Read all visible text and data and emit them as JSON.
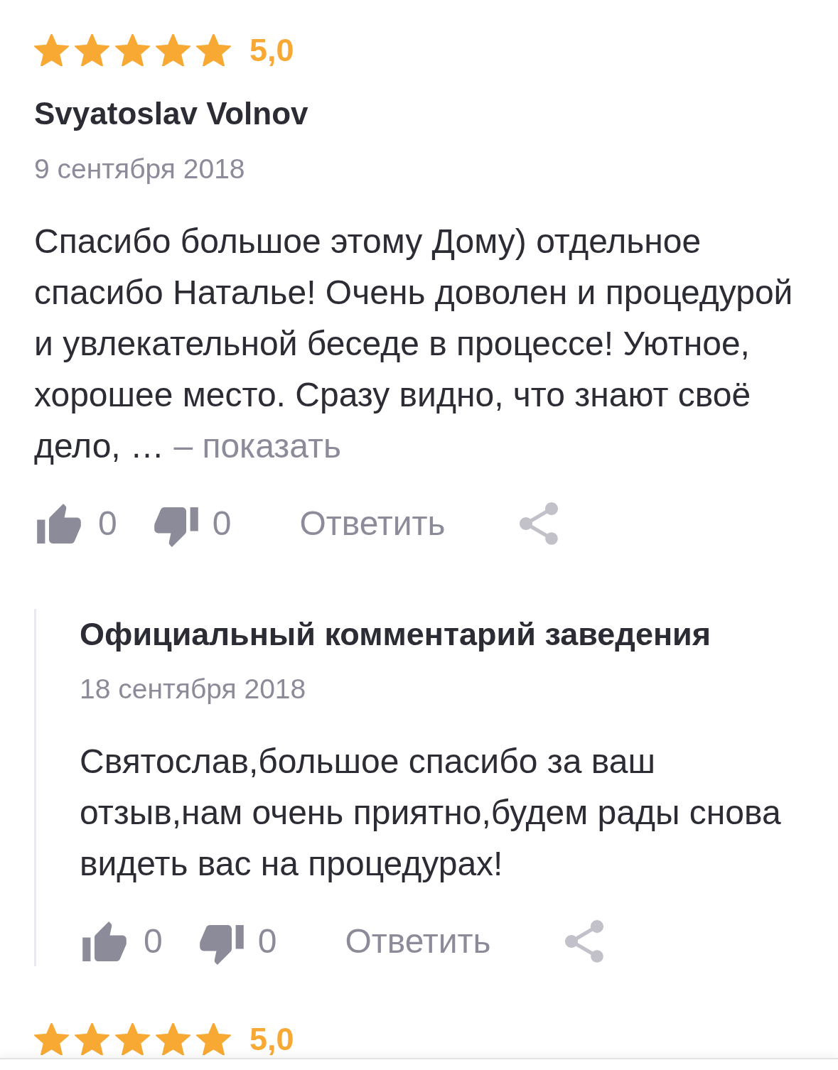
{
  "reviews": [
    {
      "stars": 5,
      "rating": "5,0",
      "author": "Svyatoslav Volnov",
      "date": "9 сентября 2018",
      "text": "Спасибо большое этому Дому) отдельное спасибо Наталье! Очень доволен и процедурой и увлекательной беседе в процессе! Уютное, хорошее место. Сразу видно, что знают своё дело, …",
      "more_link": "– показать",
      "likes": "0",
      "dislikes": "0",
      "reply_label": "Ответить",
      "official_comment": {
        "title": "Официальный комментарий заведения",
        "date": "18 сентября 2018",
        "text": "Святослав,большое спасибо за ваш отзыв,нам очень приятно,будем рады снова видеть вас на процедурах!",
        "likes": "0",
        "dislikes": "0",
        "reply_label": "Ответить"
      }
    },
    {
      "stars": 5,
      "rating": "5,0"
    }
  ]
}
